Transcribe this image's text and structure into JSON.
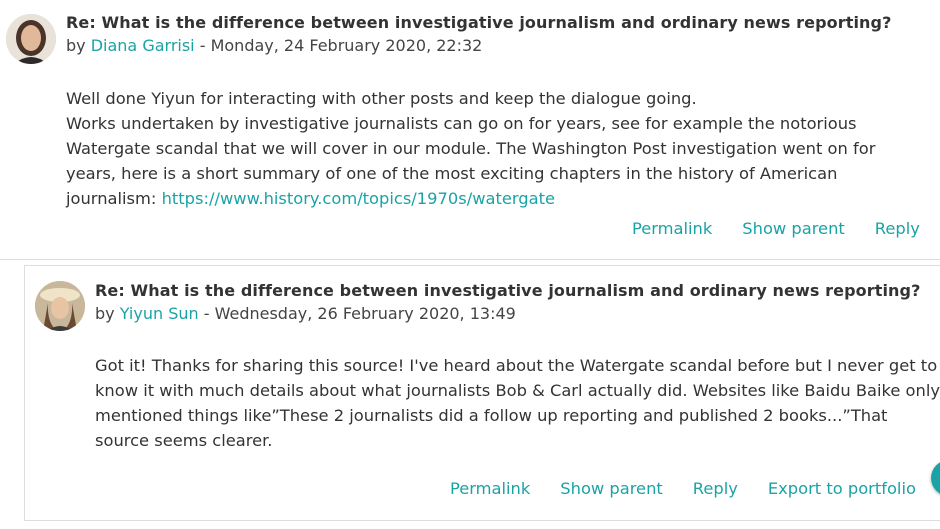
{
  "posts": [
    {
      "subject": "Re: What is the difference between investigative journalism and ordinary news reporting?",
      "by": "by",
      "author": "Diana Garrisi",
      "date": "- Monday, 24 February 2020, 22:32",
      "lines": [
        "Well done Yiyun for interacting with other posts and keep the dialogue going.",
        "Works undertaken by investigative journalists can go on for years, see for example the notorious Watergate scandal that we will cover in our module. The Washington Post investigation went on for years, here is a short summary of one of the most exciting chapters in the history of American journalism:"
      ],
      "link": "https://www.history.com/topics/1970s/watergate",
      "commands": {
        "permalink": "Permalink",
        "show_parent": "Show parent",
        "reply": "Reply"
      }
    },
    {
      "subject": "Re: What is the difference between investigative journalism and ordinary news reporting?",
      "by": "by",
      "author": "Yiyun Sun",
      "date": "- Wednesday, 26 February 2020, 13:49",
      "text": "Got it!  Thanks for sharing this source!  I've heard about the Watergate scandal before but I never get to know it with much details about what journalists Bob & Carl actually did. Websites like Baidu Baike only mentioned things like”These 2 journalists did a follow up reporting and published 2 books...”That source seems clearer.",
      "commands": {
        "permalink": "Permalink",
        "show_parent": "Show parent",
        "reply": "Reply",
        "export": "Export to portfolio"
      }
    }
  ],
  "colors": {
    "accent": "#1aa3a6",
    "text": "#333333",
    "border": "#dddddd"
  }
}
